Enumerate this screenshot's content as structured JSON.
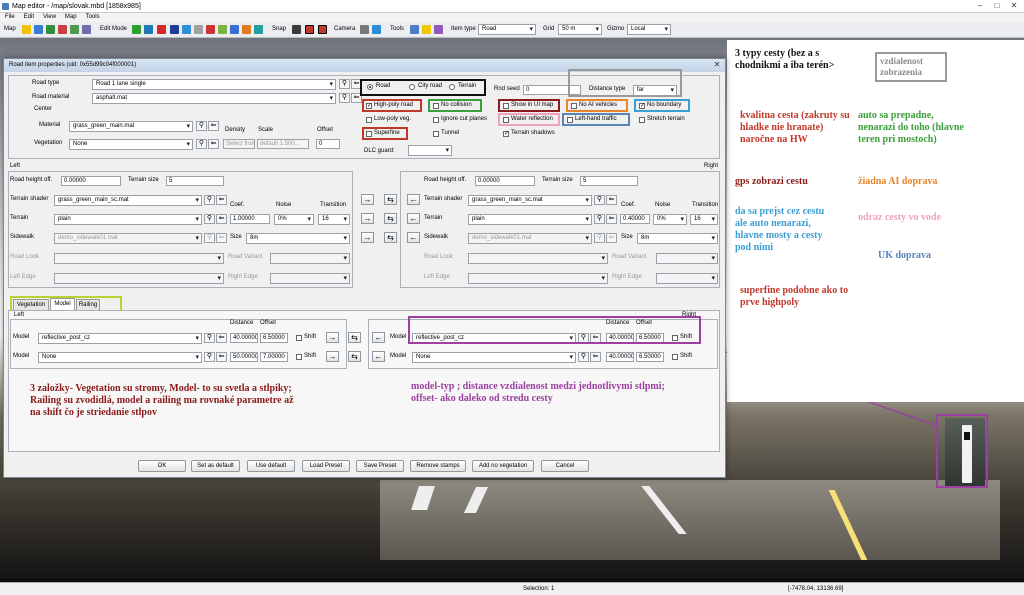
{
  "window": {
    "title": "Map editor - /map/slovak.mbd [1858x985]"
  },
  "menu": [
    "File",
    "Edit",
    "View",
    "Map",
    "Tools"
  ],
  "toolbar": {
    "map": "Map",
    "edit_mode": "Edit Mode",
    "snap": "Snap",
    "camera": "Camera",
    "tools": "Tools",
    "item_type": "Item type",
    "item_type_value": "Road",
    "grid": "Grid",
    "grid_value": "50 m",
    "gizmo": "Gizmo",
    "gizmo_value": "Local"
  },
  "dialog": {
    "title": "Road item properties (uid: 0x55d99c04f000001)",
    "road_type_label": "Road type",
    "road_type": "Road 1 lane single",
    "road_material_label": "Road material",
    "road_material": "asphalt.mat",
    "center": "Center",
    "material_label": "Material",
    "material": "grass_green_main.mat",
    "density": "Density",
    "scale": "Scale",
    "offset": "Offset",
    "vegetation_label": "Vegetation",
    "vegetation": "None",
    "veg_density": "Select from...",
    "veg_scale": "default 1.500...",
    "veg_offset": "0",
    "road_kind": [
      "Road",
      "City road",
      "Terrain"
    ],
    "rnd_seed_label": "Rnd seed",
    "rnd_seed": "0",
    "distance_type_label": "Distance type",
    "distance_type": "far",
    "flags": {
      "high_poly": "High-poly road",
      "no_collision": "No collision",
      "show_ui_map": "Show in UI map",
      "no_ai_vehicles": "No AI vehicles",
      "no_boundary": "No boundary",
      "low_poly_veg": "Low-poly veg.",
      "ignore_cut_planes": "Ignore cut planes",
      "water_reflection": "Water reflection",
      "left_hand_traffic": "Left-hand traffic",
      "stretch_terrain": "Stretch terrain",
      "superfine": "Superfine",
      "tunnel": "Tunnel",
      "terrain_shadows": "Terrain shadows"
    },
    "dlc_guard": "DLC guard:",
    "left": "Left",
    "right": "Right",
    "road_height_off": "Road height off.",
    "terrain_size": "Terrain size",
    "left_side": {
      "height": "0.00000",
      "tsize": "5",
      "shader": "grass_green_main_sc.mat",
      "terrain": "plain",
      "coef": "1.00000",
      "noise": "0%",
      "transition": "16",
      "sidewalk": "demo_sidewalk01.mat",
      "size": "8m"
    },
    "right_side": {
      "height": "0.00000",
      "tsize": "5",
      "shader": "grass_green_main_sc.mat",
      "terrain": "plain",
      "coef": "0.40000",
      "noise": "0%",
      "transition": "16",
      "sidewalk": "demo_sidewalk01.mat",
      "size": "8m"
    },
    "terrain_shader": "Terrain shader",
    "terrain": "Terrain",
    "coef": "Coef.",
    "noise": "Noise",
    "transition": "Transition",
    "sidewalk": "Sidewalk",
    "size": "Size",
    "road_look": "Road Look",
    "road_variant": "Road Variant",
    "left_edge": "Left Edge",
    "right_edge": "Right Edge",
    "tabs": [
      "Vegetation",
      "Model",
      "Railing"
    ],
    "distance": "Distance",
    "model_offset": "Offset",
    "model": "Model",
    "shift": "Shift",
    "left_models": [
      {
        "model": "reflective_post_cz",
        "distance": "40.00000",
        "offset": "6.50000"
      },
      {
        "model": "None",
        "distance": "50.00000",
        "offset": "7.00000"
      }
    ],
    "right_models": [
      {
        "model": "reflective_post_cz",
        "distance": "40.00000",
        "offset": "6.50000"
      },
      {
        "model": "None",
        "distance": "40.00000",
        "offset": "6.50000"
      }
    ],
    "buttons": [
      "OK",
      "Set as default",
      "Use default",
      "Load Preset",
      "Save Preset",
      "Remove stamps",
      "Add no vegetation",
      "Cancel"
    ]
  },
  "notes": {
    "types": "3 typy cesty (bez a s chodnikmi a iba terén>",
    "distance": "vzdialenost zobrazenia",
    "quality": "kvalitna cesta (zakruty su hladke nie hranate) naročne na HW",
    "collision": "auto sa prepadne, nenarazi do toho (hlavne teren pri mostoch)",
    "gps": "gps zobrazi cestu",
    "noai": "žiadna AI doprava",
    "boundary": "da sa prejst cez cestu ale auto nenarazi, hlavne mosty a cesty pod nimi",
    "reflection": "odraz cesty vo vode",
    "uk": "UK doprava",
    "superfine": "superfine podobne ako to prve highpoly",
    "tabs": "3 založky- Vegetation su stromy, Model- to su svetla a stlpiky; Railing su zvodidlá, model a railing ma rovnaké parametre až na shift čo je striedanie stlpov",
    "model": "model-typ ; distance vzdialenost medzi jednotlivymi stlpmi; offset- ako daleko od stredu cesty"
  },
  "status": {
    "selection": "Selection: 1",
    "coords": "[-7478.04, 13136.69]"
  },
  "colors": {
    "red": "#c0392b",
    "green": "#3aa03a",
    "blue": "#3b9fd6",
    "orange": "#e8862a",
    "pink": "#f0a3b8",
    "steel": "#5b84b8",
    "purple": "#9b3fa0",
    "brown": "#8b1a1a",
    "gray": "#9a9a9a",
    "yellow": "#b9d334"
  }
}
